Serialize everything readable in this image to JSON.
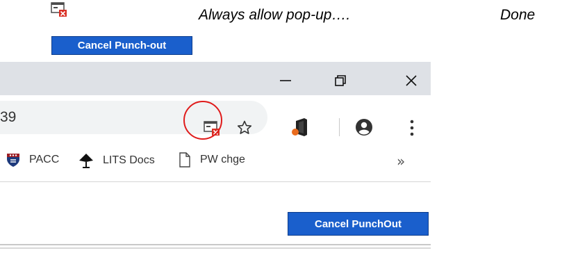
{
  "instructions": {
    "popup_text": "Always allow pop-up….",
    "done_text": "Done",
    "cancel_button_label": "Cancel Punch-out"
  },
  "browser": {
    "window_controls": {
      "minimize_glyph": "—",
      "restore_glyph": "⧉",
      "close_glyph": "✕"
    },
    "omnibox": {
      "visible_text": "39"
    },
    "toolbar_icons": [
      "popup-blocked-icon",
      "star-icon",
      "office-extension-icon",
      "account-icon",
      "menu-icon"
    ],
    "bookmarks": [
      {
        "label": "PACC",
        "icon": "penn-shield-icon"
      },
      {
        "label": "LITS Docs",
        "icon": "lamp-icon"
      },
      {
        "label": "PW chge",
        "icon": "document-icon"
      }
    ],
    "bookmarks_overflow_glyph": "»",
    "page": {
      "cancel_button_label": "Cancel PunchOut"
    }
  },
  "colors": {
    "button_blue": "#1a5fcc",
    "highlight_red": "#e01b1b",
    "titlebar_gray": "#dee1e6",
    "omnibox_gray": "#f1f3f4"
  }
}
